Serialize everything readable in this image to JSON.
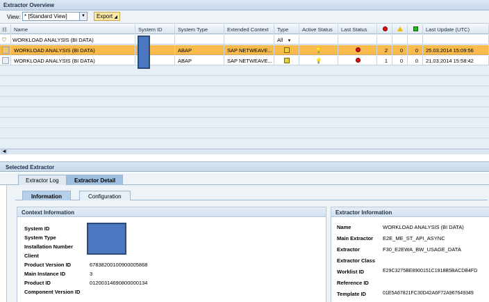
{
  "overview": {
    "title": "Extractor Overview",
    "view_label": "View:",
    "view_value": "* [Standard View]",
    "export_label": "Export"
  },
  "grid": {
    "columns": [
      "Name",
      "System ID",
      "System Type",
      "Extended Context",
      "Type",
      "Active Status",
      "Last Status",
      "",
      "",
      "",
      "Last Update (UTC)"
    ],
    "column_icons": [
      "red-alert-icon",
      "yellow-warning-icon",
      "green-ok-icon"
    ],
    "filter": {
      "name": "WORKLOAD ANALYSIS (BI DATA)",
      "type": "All"
    },
    "rows": [
      {
        "name": "WORKLOAD ANALYSIS (BI DATA)",
        "system_type": "ABAP",
        "context": "SAP NETWEAVE...",
        "red": "2",
        "yellow": "0",
        "green": "0",
        "last_update": "25.03.2014 15:09:56"
      },
      {
        "name": "WORKLOAD ANALYSIS (BI DATA)",
        "system_type": "ABAP",
        "context": "SAP NETWEAVE...",
        "red": "1",
        "yellow": "0",
        "green": "0",
        "last_update": "21.03.2014 15:58:42"
      }
    ]
  },
  "selected": {
    "title": "Selected Extractor",
    "tabs": [
      "Extractor Log",
      "Extractor Detail"
    ],
    "subtabs": [
      "Information",
      "Configuration"
    ]
  },
  "context_info": {
    "title": "Context Information",
    "labels": [
      "System ID",
      "System Type",
      "Installation Number",
      "Client",
      "Product Version ID",
      "Main Instance ID",
      "Product ID",
      "Component Version ID"
    ],
    "values": [
      "",
      "",
      "",
      "",
      "67838200100900005868",
      "3",
      "01200314690800000134",
      ""
    ]
  },
  "extractor_info": {
    "title": "Extractor Information",
    "labels": [
      "Name",
      "Main Extractor",
      "Extractor",
      "Extractor Class",
      "Worklist ID",
      "Reference ID",
      "Template ID"
    ],
    "values": [
      "WORKLOAD ANALYSIS (BI DATA)",
      "E2E_ME_ST_API_ASYNC",
      "F30_E2EWA_BW_USAGE_DATA",
      "",
      "E29C3275BE8900151C1918B5BACDB4FD",
      "",
      "01E5A67821FC30D42A6F72A967649349"
    ]
  }
}
